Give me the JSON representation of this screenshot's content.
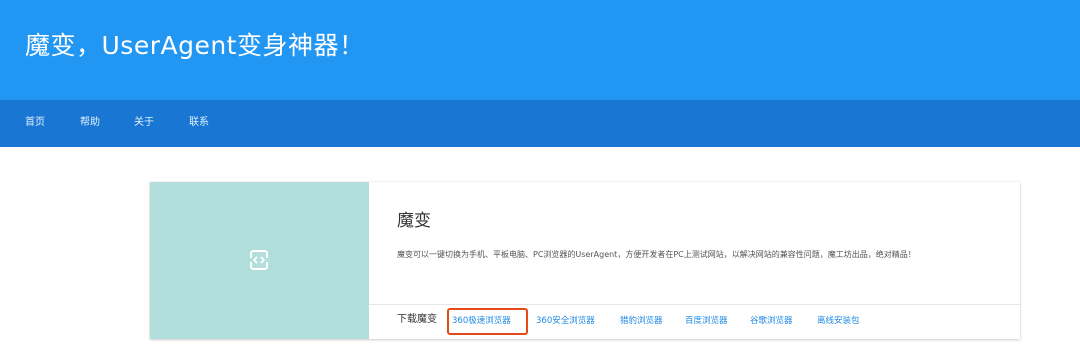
{
  "header": {
    "title": "魔变，UserAgent变身神器！"
  },
  "nav": {
    "items": [
      "首页",
      "帮助",
      "关于",
      "联系"
    ]
  },
  "card": {
    "icon": "code-brackets-icon",
    "title": "魔变",
    "description": "魔变可以一键切换为手机、平板电脑、PC浏览器的UserAgent，方便开发者在PC上测试网站，以解决网站的兼容性问题，魔工坊出品，绝对精品！",
    "download_label": "下载魔变",
    "download_links": [
      "360极速浏览器",
      "360安全浏览器",
      "猎豹浏览器",
      "百度浏览器",
      "谷歌浏览器",
      "离线安装包"
    ],
    "highlighted_link": "360极速浏览器"
  },
  "colors": {
    "header": "#2196f3",
    "nav": "#1976d2",
    "card_media": "#b2dfdb",
    "link": "#1e88e5",
    "highlight": "#e64a19"
  }
}
